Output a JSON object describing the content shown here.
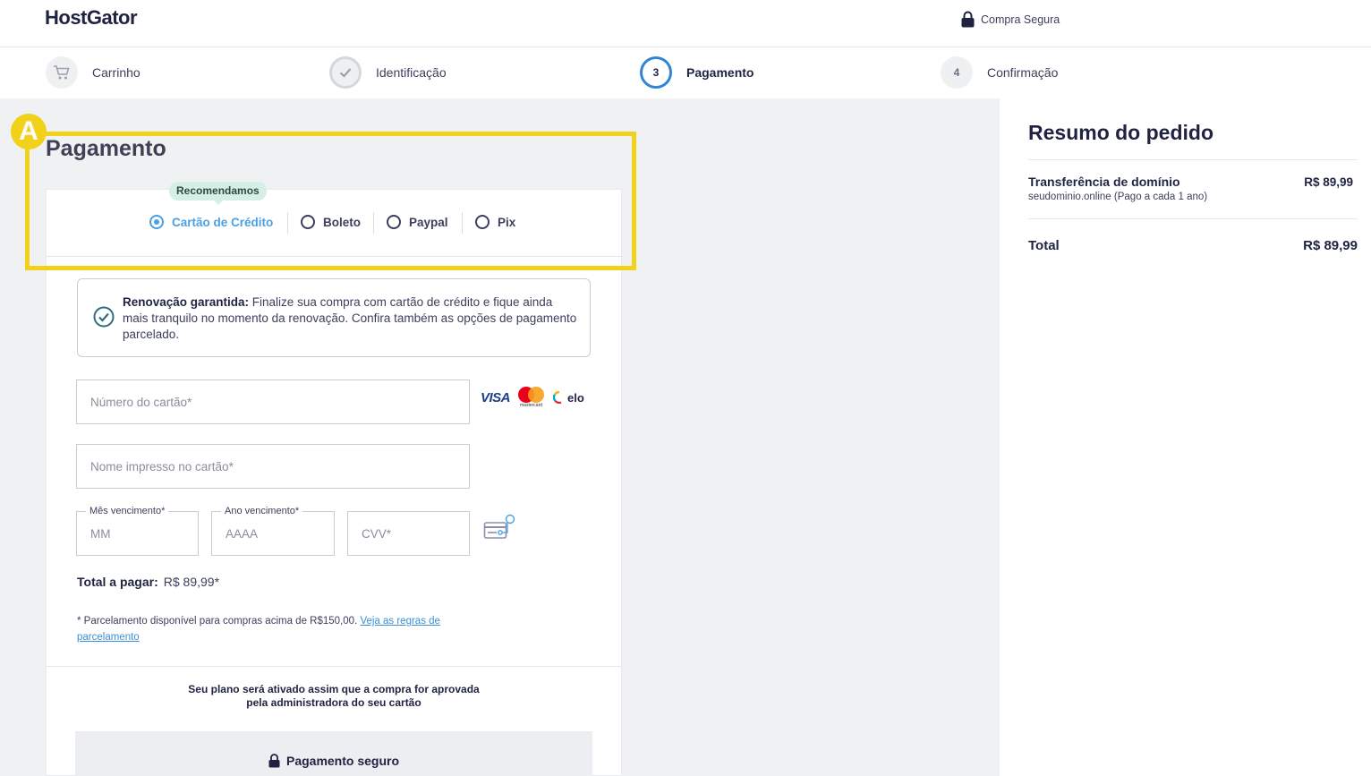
{
  "header": {
    "logo": "HostGator",
    "secure_label": "Compra Segura"
  },
  "steps": [
    {
      "number": "",
      "label": "Carrinho",
      "state": "done"
    },
    {
      "number": "",
      "label": "Identificação",
      "state": "done"
    },
    {
      "number": "3",
      "label": "Pagamento",
      "state": "active"
    },
    {
      "number": "4",
      "label": "Confirmação",
      "state": "pending"
    }
  ],
  "payment": {
    "title": "Pagamento",
    "recommended_badge": "Recomendamos",
    "options": [
      {
        "label": "Cartão de Crédito",
        "selected": true
      },
      {
        "label": "Boleto",
        "selected": false
      },
      {
        "label": "Paypal",
        "selected": false
      },
      {
        "label": "Pix",
        "selected": false
      }
    ],
    "annotation_marker": "A",
    "info": {
      "bold": "Renovação garantida:",
      "text": " Finalize sua compra com cartão de crédito e fique ainda mais tranquilo no momento da renovação. Confira também as opções de pagamento parcelado."
    },
    "fields": {
      "card_number_placeholder": "Número do cartão*",
      "card_name_placeholder": "Nome impresso no cartão*",
      "month_label": "Mês vencimento*",
      "month_placeholder": "MM",
      "year_label": "Ano vencimento*",
      "year_placeholder": "AAAA",
      "cvv_placeholder": "CVV*"
    },
    "brands": {
      "visa": "VISA",
      "mastercard": "mastercard",
      "elo": "elo"
    },
    "total_label": "Total a pagar:",
    "total_value": "R$ 89,99*",
    "installment_note": "* Parcelamento disponível para compras acima de R$150,00.",
    "installment_link": "Veja as regras de parcelamento",
    "activation_line1": "Seu plano será ativado assim que a compra for aprovada",
    "activation_line2": "pela administradora do seu cartão",
    "secure_payment": "Pagamento seguro"
  },
  "summary": {
    "title": "Resumo do pedido",
    "item_name": "Transferência de domínio",
    "item_sub": "seudominio.online (Pago a cada 1 ano)",
    "item_price": "R$ 89,99",
    "total_label": "Total",
    "total_price": "R$ 89,99"
  },
  "colors": {
    "accent": "#2f86d6",
    "highlight": "#f2d11b",
    "recommended_bg": "#d6efe6"
  }
}
